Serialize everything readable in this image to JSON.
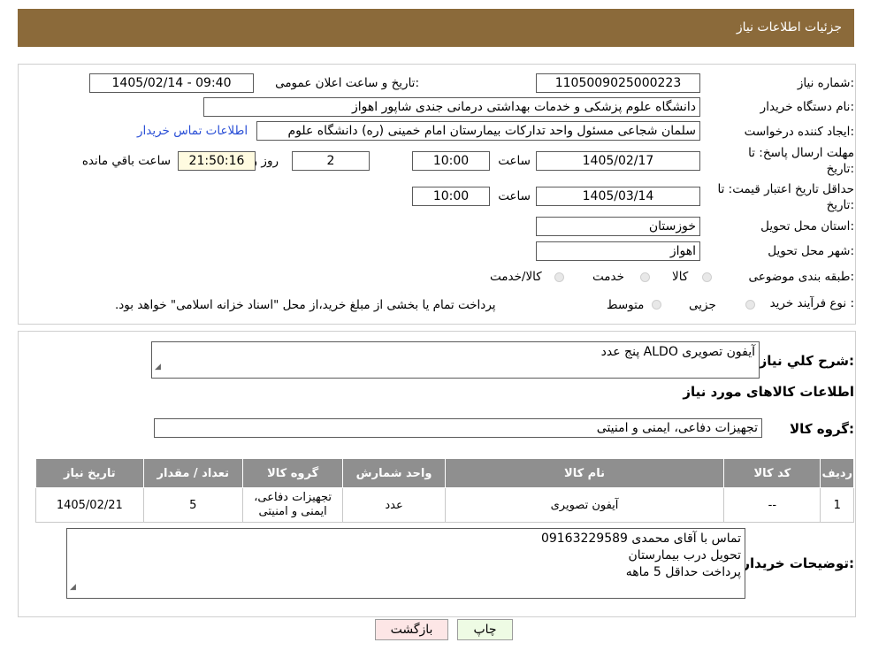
{
  "header": {
    "title": "جزئیات اطلاعات نیاز"
  },
  "form": {
    "need_number_label": "شماره نیاز:",
    "need_number": "1105009025000223",
    "announce_label": "تاریخ و ساعت اعلان عمومی:",
    "announce_value": "1405/02/14 - 09:40",
    "buyer_org_label": "نام دستگاه خریدار:",
    "buyer_org": "دانشگاه علوم پزشکی و خدمات بهداشتی درمانی جندی شاپور اهواز",
    "creator_label": "ایجاد کننده درخواست:",
    "creator": "سلمان شجاعی مسئول واحد تدارکات بیمارستان امام خمینی (ره) دانشگاه علوم",
    "contact_link": "اطلاعات تماس خریدار",
    "deadline_label_1": "مهلت ارسال پاسخ: تا",
    "deadline_label_2": "تاریخ:",
    "deadline_date": "1405/02/17",
    "time_label": "ساعت",
    "deadline_time": "10:00",
    "days_value": "2",
    "days_label": "روز و",
    "remaining_time": "21:50:16",
    "remaining_label": "ساعت باقي مانده",
    "validity_label_1": "حداقل تاریخ اعتبار قیمت: تا",
    "validity_label_2": "تاریخ:",
    "validity_date": "1405/03/14",
    "validity_time": "10:00",
    "province_label": "استان محل تحویل:",
    "province": "خوزستان",
    "city_label": "شهر محل تحویل:",
    "city": "اهواز",
    "category_label": "طبقه بندی موضوعی:",
    "category_options": [
      "کالا",
      "خدمت",
      "کالا/خدمت"
    ],
    "process_label": "نوع فرآیند خرید :",
    "process_options": [
      "جزیی",
      "متوسط"
    ],
    "process_note": "پرداخت تمام یا بخشی از مبلغ خرید،از محل \"اسناد خزانه اسلامی\" خواهد بود."
  },
  "summary": {
    "label": "شرح کلي نياز:",
    "value": "آیفون تصویری     ALDO     پنج عدد"
  },
  "goods_title": "اطلاعات کالاهای مورد نیاز",
  "group": {
    "label": "گروه کالا:",
    "value": "تجهیزات دفاعی، ایمنی و امنیتی"
  },
  "table": {
    "headers": [
      "ردیف",
      "کد کالا",
      "نام کالا",
      "واحد شمارش",
      "گروه کالا",
      "تعداد / مقدار",
      "تاریخ نیاز"
    ],
    "rows": [
      [
        "1",
        "--",
        "آیفون تصویری",
        "عدد",
        "تجهیزات دفاعی، ایمنی و امنیتی",
        "5",
        "1405/02/21"
      ]
    ]
  },
  "buyer_notes": {
    "label": "توضیحات خریدار:",
    "lines": [
      "تماس با آقای محمدی 09163229589",
      "تحویل درب بیمارستان",
      "پرداخت حداقل 5 ماهه"
    ]
  },
  "buttons": {
    "print": "چاپ",
    "back": "بازگشت"
  },
  "colors": {
    "header_bg": "#8b6a3a",
    "table_header_bg": "#8f8f8f",
    "link": "#2a4fd6",
    "print_bg": "#eefbe4",
    "back_bg": "#fde6e6"
  }
}
